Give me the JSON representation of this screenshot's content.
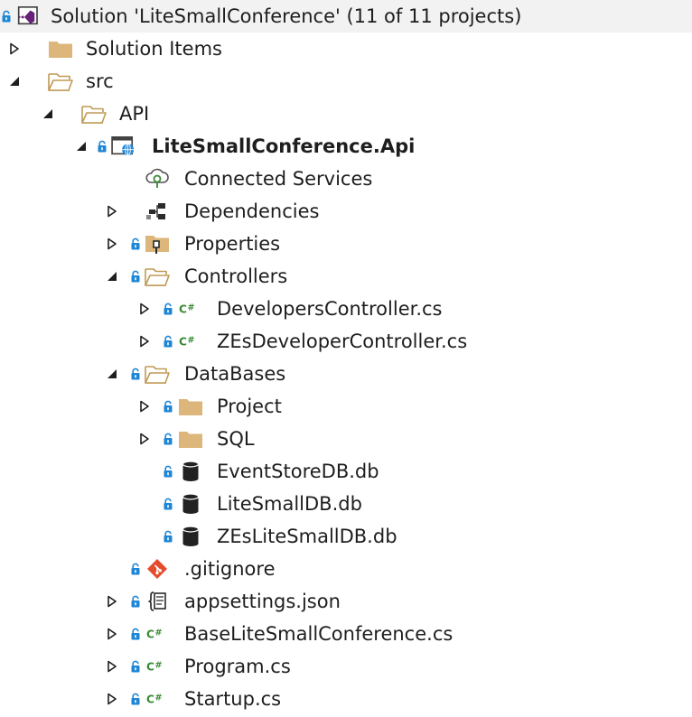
{
  "tree": {
    "solution_label": "Solution 'LiteSmallConference' (11 of 11 projects)",
    "solution_items_label": "Solution Items",
    "src_label": "src",
    "api_folder_label": "API",
    "project_label": "LiteSmallConference.Api",
    "connected_services_label": "Connected Services",
    "dependencies_label": "Dependencies",
    "properties_label": "Properties",
    "controllers_label": "Controllers",
    "developers_controller_label": "DevelopersController.cs",
    "zes_developer_controller_label": "ZEsDeveloperController.cs",
    "databases_label": "DataBases",
    "project_folder_label": "Project",
    "sql_folder_label": "SQL",
    "eventstore_db_label": "EventStoreDB.db",
    "litesmall_db_label": "LiteSmallDB.db",
    "zes_litesmall_db_label": "ZEsLiteSmallDB.db",
    "gitignore_label": ".gitignore",
    "appsettings_label": "appsettings.json",
    "base_conference_label": "BaseLiteSmallConference.cs",
    "program_label": "Program.cs",
    "startup_label": "Startup.cs"
  },
  "icons": {
    "lock": "lock-icon",
    "folder": "folder-icon",
    "open_folder": "open-folder-icon",
    "csharp": "csharp-file-icon",
    "database": "database-icon",
    "git": "git-icon",
    "json": "json-file-icon",
    "web_project": "web-project-icon",
    "solution": "visual-studio-solution-icon",
    "connected_services": "connected-services-icon",
    "dependencies": "dependencies-icon",
    "properties": "properties-folder-icon"
  },
  "colors": {
    "lock": "#1e86d6",
    "folder": "#dcb67a",
    "csharp": "#388a34",
    "git": "#e44c2c",
    "database": "#222222",
    "vs_purple": "#68217a"
  }
}
